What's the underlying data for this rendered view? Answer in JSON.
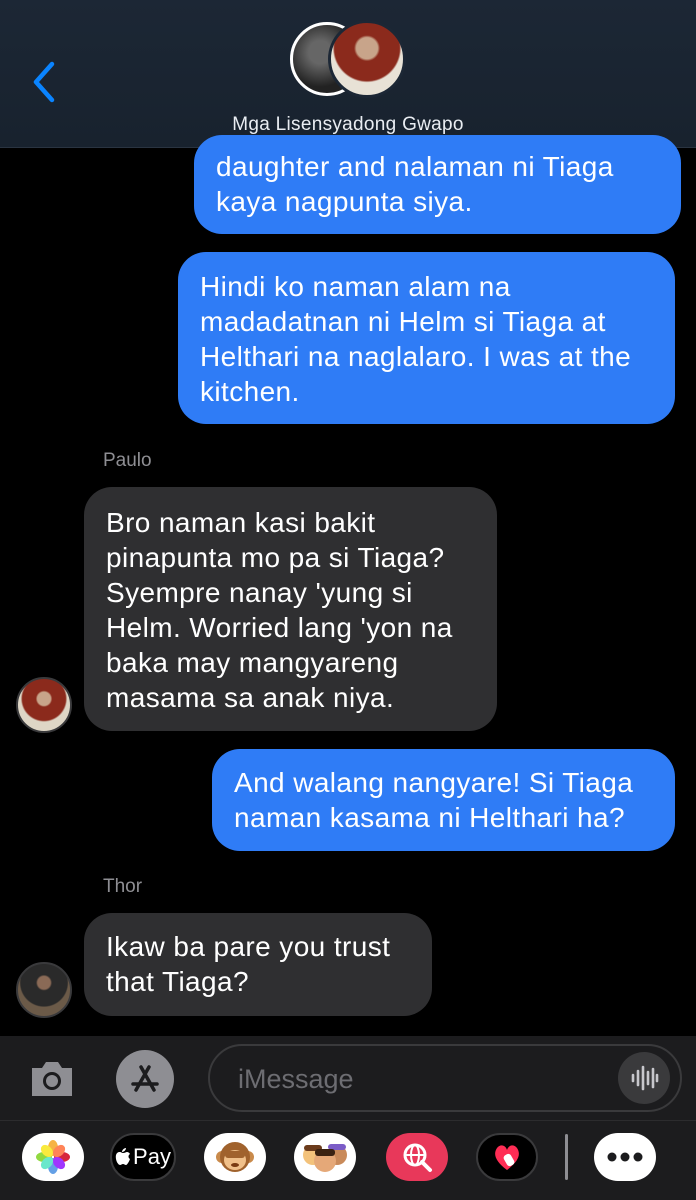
{
  "header": {
    "group_name": "Mga Lisensyadong Gwapo"
  },
  "messages": [
    {
      "direction": "out",
      "text": "daughter and nalaman ni Tiaga\nkaya nagpunta siya."
    },
    {
      "direction": "out",
      "text": "Hindi ko naman alam na\nmadadatnan ni Helm si Tiaga at\nHelthari na naglalaro. I was at the\nkitchen."
    },
    {
      "direction": "in",
      "sender": "Paulo",
      "text": "Bro naman kasi bakit\npinapunta mo pa si Tiaga?\nSyempre nanay 'yung si\nHelm. Worried lang 'yon na\nbaka may mangyareng\nmasama sa anak niya."
    },
    {
      "direction": "out",
      "text": "And walang nangyare! Si Tiaga\nnaman kasama ni Helthari ha?"
    },
    {
      "direction": "in",
      "sender": "Thor",
      "text": "Ikaw ba pare you trust\nthat Tiaga?"
    }
  ],
  "input": {
    "placeholder": "iMessage"
  },
  "apps": {
    "apple_pay_label": "Pay"
  },
  "colors": {
    "outgoing_bubble": "#2f7cf6",
    "incoming_bubble": "#2f2f31",
    "accent": "#0a84ff"
  }
}
